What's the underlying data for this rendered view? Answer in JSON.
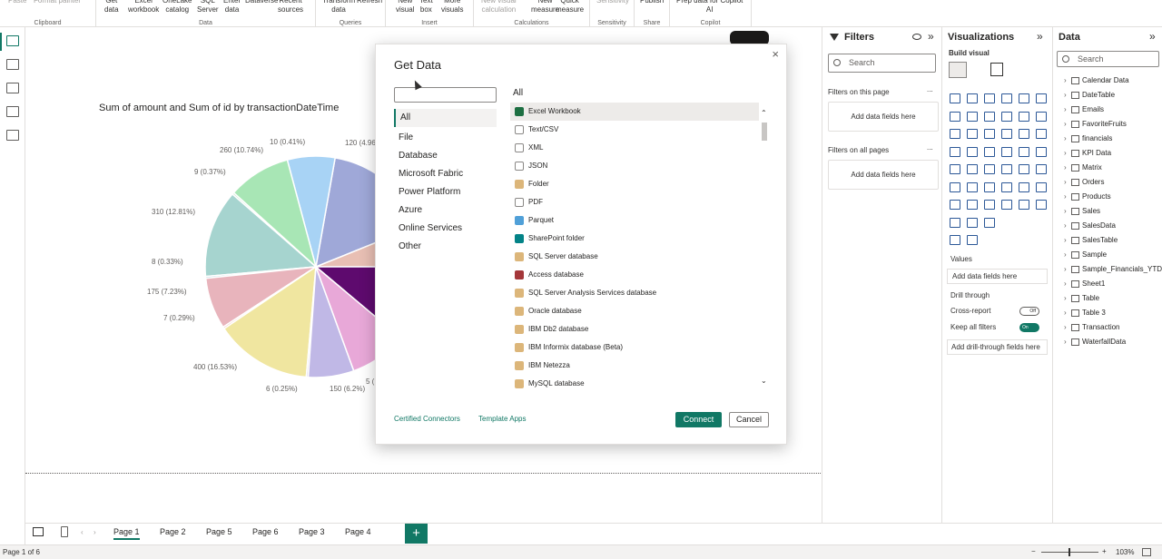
{
  "ribbon": {
    "buttons": [
      {
        "label": "Paste"
      },
      {
        "label": "Format painter"
      },
      {
        "label": "Get\ndata"
      },
      {
        "label": "Excel\nworkbook"
      },
      {
        "label": "OneLake\ncatalog"
      },
      {
        "label": "SQL\nServer"
      },
      {
        "label": "Enter\ndata"
      },
      {
        "label": "Dataverse"
      },
      {
        "label": "Recent\nsources"
      },
      {
        "label": "Transform\ndata"
      },
      {
        "label": "Refresh"
      },
      {
        "label": "New\nvisual"
      },
      {
        "label": "Text\nbox"
      },
      {
        "label": "More\nvisuals"
      },
      {
        "label": "New visual\ncalculation"
      },
      {
        "label": "New\nmeasure"
      },
      {
        "label": "Quick\nmeasure"
      },
      {
        "label": "Sensitivity"
      },
      {
        "label": "Publish"
      },
      {
        "label": "Prep data for Copilot\nAI"
      }
    ],
    "groups": [
      "Clipboard",
      "Data",
      "Queries",
      "Insert",
      "Calculations",
      "Sensitivity",
      "Share",
      "Copilot"
    ]
  },
  "chart": {
    "title": "Sum of amount and Sum of id by transactionDateTime"
  },
  "chart_data": {
    "type": "pie",
    "title": "Sum of amount and Sum of id by transactionDateTime",
    "slices": [
      {
        "label": "120 (4.96...",
        "value": 120,
        "pct": 4.96,
        "color": "#9fa8d8"
      },
      {
        "label": "10 (0.41%)",
        "value": 10,
        "pct": 0.41,
        "color": "#a8d3f5"
      },
      {
        "label": "260 (10.74%)",
        "value": 260,
        "pct": 10.74,
        "color": "#a8e6b5"
      },
      {
        "label": "9 (0.37%)",
        "value": 9,
        "pct": 0.37,
        "color": "#c8e6d0"
      },
      {
        "label": "310 (12.81%)",
        "value": 310,
        "pct": 12.81,
        "color": "#a6d4cf"
      },
      {
        "label": "8 (0.33%)",
        "value": 8,
        "pct": 0.33,
        "color": "#bcd8e0"
      },
      {
        "label": "175 (7.23%)",
        "value": 175,
        "pct": 7.23,
        "color": "#e8b4bc"
      },
      {
        "label": "7 (0.29%)",
        "value": 7,
        "pct": 0.29,
        "color": "#f2c4c4"
      },
      {
        "label": "400 (16.53%)",
        "value": 400,
        "pct": 16.53,
        "color": "#f0e6a0"
      },
      {
        "label": "6 (0.25%)",
        "value": 6,
        "pct": 0.25,
        "color": "#d6d0ec"
      },
      {
        "label": "150 (6.2%)",
        "value": 150,
        "pct": 6.2,
        "color": "#c0b8e6"
      },
      {
        "label": "5 (...",
        "value": 5,
        "pct": 0.2,
        "color": "#e8a8d8"
      }
    ]
  },
  "pages": [
    "Page 1",
    "Page 2",
    "Page 5",
    "Page 6",
    "Page 3",
    "Page 4"
  ],
  "add_page": "+",
  "status": {
    "page": "Page 1 of 6",
    "zoom": "103%",
    "minus": "−",
    "plus": "+"
  },
  "filters": {
    "title": "Filters",
    "search": "Search",
    "on_page": "Filters on this page",
    "on_all": "Filters on all pages",
    "add1": "Add data fields here",
    "add2": "Add data fields here",
    "more": "..."
  },
  "viz": {
    "title": "Visualizations",
    "build": "Build visual",
    "values": "Values",
    "values_add": "Add data fields here",
    "drill": "Drill through",
    "cross": "Cross-report",
    "cross_state": "Off",
    "keep": "Keep all filters",
    "keep_state": "On",
    "drill_add": "Add drill-through fields here",
    "r_icon": "R",
    "py_icon": "Py",
    "more_icon": "···"
  },
  "data": {
    "title": "Data",
    "search": "Search",
    "items": [
      "Calendar Data",
      "DateTable",
      "Emails",
      "FavoriteFruits",
      "financials",
      "KPI Data",
      "Matrix",
      "Orders",
      "Products",
      "Sales",
      "SalesData",
      "SalesTable",
      "Sample",
      "Sample_Financials_YTD",
      "Sheet1",
      "Table",
      "Table 3",
      "Transaction",
      "WaterfallData"
    ]
  },
  "dialog": {
    "title": "Get Data",
    "close": "×",
    "categories": [
      "All",
      "File",
      "Database",
      "Microsoft Fabric",
      "Power Platform",
      "Azure",
      "Online Services",
      "Other"
    ],
    "list_header": "All",
    "sources": [
      {
        "name": "Excel Workbook",
        "color": "#1d6f42"
      },
      {
        "name": "Text/CSV",
        "color": "#ffffff"
      },
      {
        "name": "XML",
        "color": "#ffffff"
      },
      {
        "name": "JSON",
        "color": "#ffffff"
      },
      {
        "name": "Folder",
        "color": "#dcb67a"
      },
      {
        "name": "PDF",
        "color": "#ffffff"
      },
      {
        "name": "Parquet",
        "color": "#50a0d8"
      },
      {
        "name": "SharePoint folder",
        "color": "#038387"
      },
      {
        "name": "SQL Server database",
        "color": "#dcb67a"
      },
      {
        "name": "Access database",
        "color": "#a4373a"
      },
      {
        "name": "SQL Server Analysis Services database",
        "color": "#dcb67a"
      },
      {
        "name": "Oracle database",
        "color": "#dcb67a"
      },
      {
        "name": "IBM Db2 database",
        "color": "#dcb67a"
      },
      {
        "name": "IBM Informix database (Beta)",
        "color": "#dcb67a"
      },
      {
        "name": "IBM Netezza",
        "color": "#dcb67a"
      },
      {
        "name": "MySQL database",
        "color": "#dcb67a"
      }
    ],
    "certified": "Certified Connectors",
    "template": "Template Apps",
    "connect": "Connect",
    "cancel": "Cancel"
  }
}
